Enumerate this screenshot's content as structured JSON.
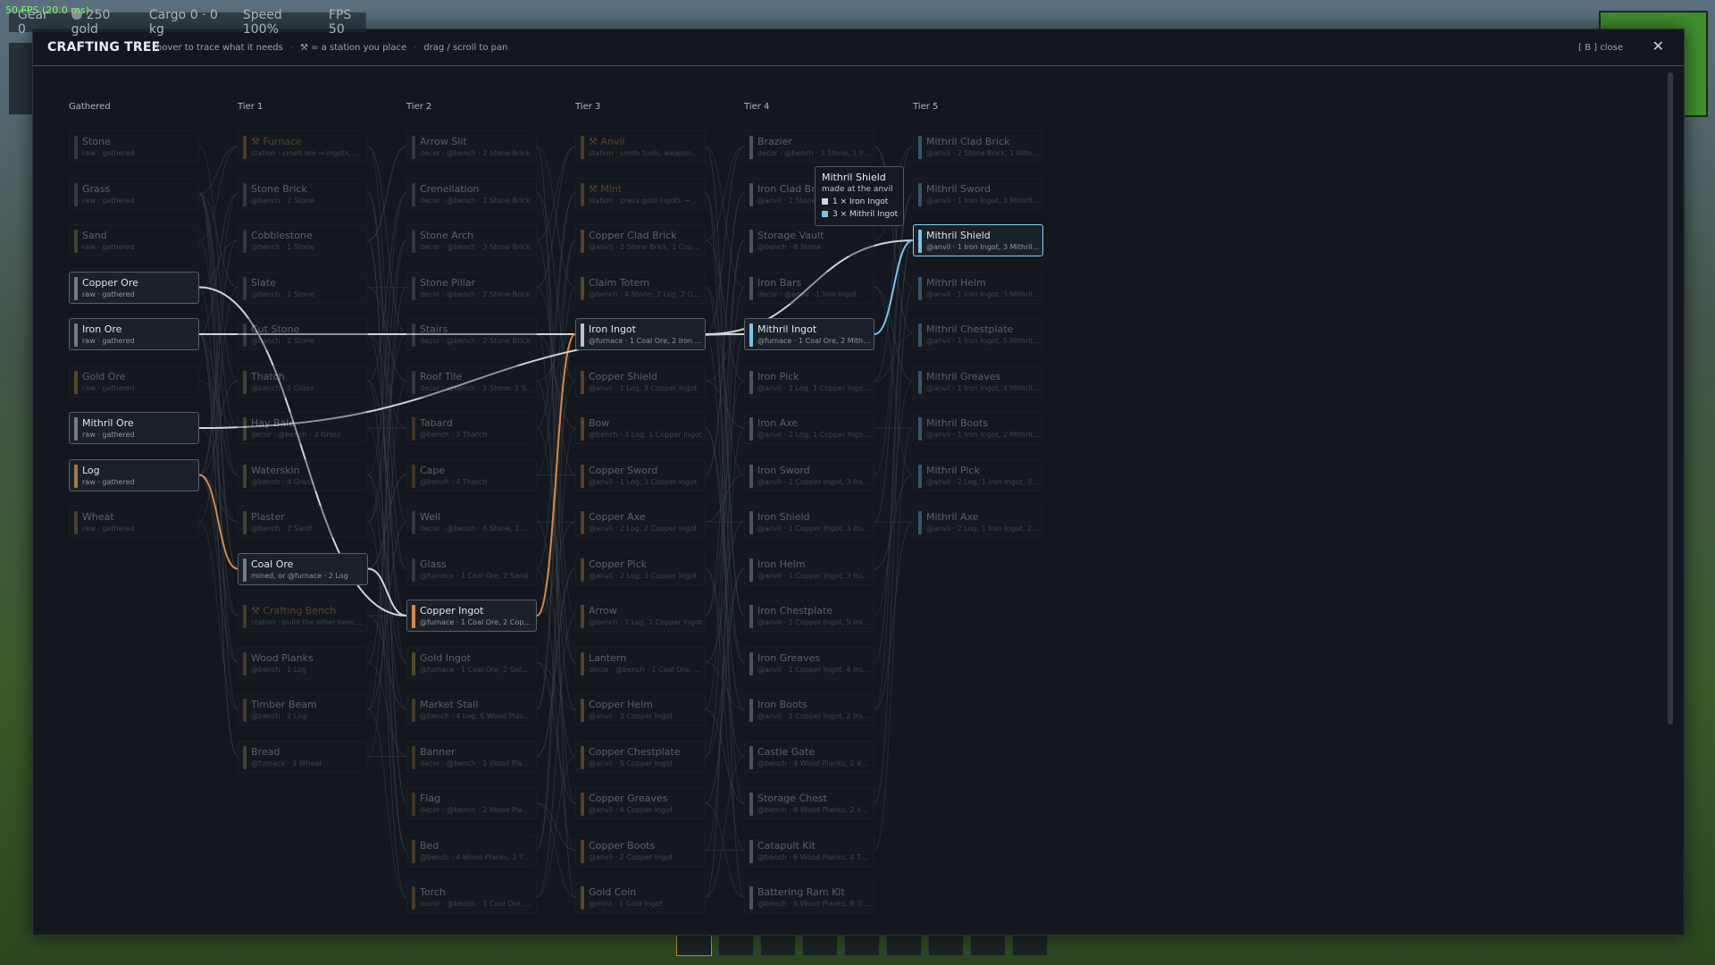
{
  "colors": {
    "raw": "#737c85",
    "station": "#b28432",
    "copper": "#d98845",
    "iron": "#bcc3ca",
    "mithril": "#77c6e6",
    "gold": "#c9a23a",
    "wood": "#a47a48",
    "food": "#a58b55",
    "stone": "#6d757d",
    "decor": "#8d6a3a",
    "selected": "#7fd3f2",
    "accent": "#c9913a"
  },
  "overlay": {
    "fps": "50 FPS  (20.0 ms)"
  },
  "hud": {
    "gear": "Gear 0",
    "gold": "250 gold",
    "cargo": "Cargo 0 · 0 kg",
    "speed": "Speed 100%",
    "fps": "FPS 50"
  },
  "modal": {
    "title": "CRAFTING TREE",
    "hints": [
      "hover to trace what it needs",
      "⚒ = a station you place",
      "drag / scroll to pan"
    ],
    "hint_sep": "·",
    "close_hint": "[ B ]  close",
    "close_icon": "✕"
  },
  "tooltip": {
    "title": "Mithril Shield",
    "subtitle": "made at the anvil",
    "items": [
      {
        "label": "1 × Iron Ingot",
        "color": "#cfd5da"
      },
      {
        "label": "3 × Mithril Ingot",
        "color": "#77c6e6"
      }
    ]
  },
  "columns": [
    {
      "header": "Gathered",
      "nodes": [
        {
          "name": "Stone",
          "sub": "raw · gathered",
          "kind": "stone",
          "hl": false
        },
        {
          "name": "Grass",
          "sub": "raw · gathered",
          "kind": "raw",
          "hl": false
        },
        {
          "name": "Sand",
          "sub": "raw · gathered",
          "kind": "food",
          "hl": false
        },
        {
          "name": "Copper Ore",
          "sub": "raw · gathered",
          "kind": "raw",
          "hl": true
        },
        {
          "name": "Iron Ore",
          "sub": "raw · gathered",
          "kind": "raw",
          "hl": true
        },
        {
          "name": "Gold Ore",
          "sub": "raw · gathered",
          "kind": "gold",
          "hl": false
        },
        {
          "name": "Mithril Ore",
          "sub": "raw · gathered",
          "kind": "raw",
          "hl": true
        },
        {
          "name": "Log",
          "sub": "raw · gathered",
          "kind": "wood",
          "hl": true
        },
        {
          "name": "Wheat",
          "sub": "raw · gathered",
          "kind": "food",
          "hl": false
        }
      ]
    },
    {
      "header": "Tier 1",
      "nodes": [
        {
          "name": "⚒ Furnace",
          "sub": "station · smelt ore → ingots, ...",
          "kind": "station",
          "hl": false
        },
        {
          "name": "Stone Brick",
          "sub": "@bench · 2 Stone",
          "kind": "stone",
          "hl": false
        },
        {
          "name": "Cobblestone",
          "sub": "@bench · 1 Stone",
          "kind": "stone",
          "hl": false
        },
        {
          "name": "Slate",
          "sub": "@bench · 2 Stone",
          "kind": "stone",
          "hl": false
        },
        {
          "name": "Cut Stone",
          "sub": "@bench · 2 Stone",
          "kind": "stone",
          "hl": false
        },
        {
          "name": "Thatch",
          "sub": "@bench · 2 Grass",
          "kind": "food",
          "hl": false
        },
        {
          "name": "Hay Bale",
          "sub": "decor · @bench · 3 Grass",
          "kind": "food",
          "hl": false
        },
        {
          "name": "Waterskin",
          "sub": "@bench · 4 Grass",
          "kind": "food",
          "hl": false
        },
        {
          "name": "Plaster",
          "sub": "@bench · 2 Sand",
          "kind": "food",
          "hl": false
        },
        {
          "name": "Coal Ore",
          "sub": "mined, or @furnace · 2 Log",
          "kind": "raw",
          "hl": true
        },
        {
          "name": "⚒ Crafting Bench",
          "sub": "station · build the other benc...",
          "kind": "station",
          "hl": false
        },
        {
          "name": "Wood Planks",
          "sub": "@bench · 1 Log",
          "kind": "wood",
          "hl": false
        },
        {
          "name": "Timber Beam",
          "sub": "@bench · 2 Log",
          "kind": "wood",
          "hl": false
        },
        {
          "name": "Bread",
          "sub": "@furnace · 3 Wheat",
          "kind": "food",
          "hl": false
        }
      ]
    },
    {
      "header": "Tier 2",
      "nodes": [
        {
          "name": "Arrow Slit",
          "sub": "decor · @bench · 2 Stone Brick",
          "kind": "stone",
          "hl": false
        },
        {
          "name": "Crenellation",
          "sub": "decor · @bench · 2 Stone Brick",
          "kind": "stone",
          "hl": false
        },
        {
          "name": "Stone Arch",
          "sub": "decor · @bench · 3 Stone Brick",
          "kind": "stone",
          "hl": false
        },
        {
          "name": "Stone Pillar",
          "sub": "decor · @bench · 2 Stone Brick",
          "kind": "stone",
          "hl": false
        },
        {
          "name": "Stairs",
          "sub": "decor · @bench · 2 Stone Brick",
          "kind": "stone",
          "hl": false
        },
        {
          "name": "Roof Tile",
          "sub": "decor · @bench · 1 Stone, 1 Sl...",
          "kind": "stone",
          "hl": false
        },
        {
          "name": "Tabard",
          "sub": "@bench · 3 Thatch",
          "kind": "decor",
          "hl": false
        },
        {
          "name": "Cape",
          "sub": "@bench · 4 Thatch",
          "kind": "decor",
          "hl": false
        },
        {
          "name": "Well",
          "sub": "decor · @bench · 6 Stone, 2 W...",
          "kind": "stone",
          "hl": false
        },
        {
          "name": "Glass",
          "sub": "@furnace · 1 Coal Ore, 2 Sand",
          "kind": "stone",
          "hl": false
        },
        {
          "name": "Copper Ingot",
          "sub": "@furnace · 1 Coal Ore, 2 Copp...",
          "kind": "copper",
          "hl": true
        },
        {
          "name": "Gold Ingot",
          "sub": "@furnace · 1 Coal Ore, 2 Gold ...",
          "kind": "gold",
          "hl": false
        },
        {
          "name": "Market Stall",
          "sub": "@bench · 4 Log, 6 Wood Plan...",
          "kind": "wood",
          "hl": false
        },
        {
          "name": "Banner",
          "sub": "decor · @bench · 1 Wood Plan...",
          "kind": "decor",
          "hl": false
        },
        {
          "name": "Flag",
          "sub": "decor · @bench · 2 Wood Plan...",
          "kind": "decor",
          "hl": false
        },
        {
          "name": "Bed",
          "sub": "@bench · 4 Wood Planks, 2 Th...",
          "kind": "wood",
          "hl": false
        },
        {
          "name": "Torch",
          "sub": "decor · @bench · 1 Coal Ore, ...",
          "kind": "wood",
          "hl": false
        }
      ]
    },
    {
      "header": "Tier 3",
      "nodes": [
        {
          "name": "⚒ Anvil",
          "sub": "station · smith tools, weapon...",
          "kind": "station",
          "hl": false
        },
        {
          "name": "⚒ Mint",
          "sub": "station · press gold ingots → c...",
          "kind": "station",
          "hl": false
        },
        {
          "name": "Copper Clad Brick",
          "sub": "@anvil · 2 Stone Brick, 1 Copp...",
          "kind": "copper",
          "hl": false
        },
        {
          "name": "Claim Totem",
          "sub": "@bench · 4 Stone, 2 Log, 2 Go...",
          "kind": "gold",
          "hl": false
        },
        {
          "name": "Iron Ingot",
          "sub": "@furnace · 1 Coal Ore, 2 Iron ...",
          "kind": "iron",
          "hl": true
        },
        {
          "name": "Copper Shield",
          "sub": "@anvil · 1 Log, 3 Copper Ingot",
          "kind": "copper",
          "hl": false
        },
        {
          "name": "Bow",
          "sub": "@bench · 3 Log, 1 Copper Ingot",
          "kind": "copper",
          "hl": false
        },
        {
          "name": "Copper Sword",
          "sub": "@anvil · 1 Log, 3 Copper Ingot",
          "kind": "copper",
          "hl": false
        },
        {
          "name": "Copper Axe",
          "sub": "@anvil · 2 Log, 2 Copper Ingot",
          "kind": "copper",
          "hl": false
        },
        {
          "name": "Copper Pick",
          "sub": "@anvil · 2 Log, 3 Copper Ingot",
          "kind": "copper",
          "hl": false
        },
        {
          "name": "Arrow",
          "sub": "@bench · 1 Log, 1 Copper Ingot",
          "kind": "copper",
          "hl": false
        },
        {
          "name": "Lantern",
          "sub": "decor · @bench · 1 Coal Ore, ...",
          "kind": "copper",
          "hl": false
        },
        {
          "name": "Copper Helm",
          "sub": "@anvil · 3 Copper Ingot",
          "kind": "copper",
          "hl": false
        },
        {
          "name": "Copper Chestplate",
          "sub": "@anvil · 5 Copper Ingot",
          "kind": "copper",
          "hl": false
        },
        {
          "name": "Copper Greaves",
          "sub": "@anvil · 4 Copper Ingot",
          "kind": "copper",
          "hl": false
        },
        {
          "name": "Copper Boots",
          "sub": "@anvil · 2 Copper Ingot",
          "kind": "copper",
          "hl": false
        },
        {
          "name": "Gold Coin",
          "sub": "@mint · 1 Gold Ingot",
          "kind": "gold",
          "hl": false
        }
      ]
    },
    {
      "header": "Tier 4",
      "nodes": [
        {
          "name": "Brazier",
          "sub": "decor · @bench · 3 Stone, 1 Ir...",
          "kind": "iron",
          "hl": false
        },
        {
          "name": "Iron Clad Brick",
          "sub": "@anvil · 2 Stone Brick, 1 Iron I...",
          "kind": "iron",
          "hl": false
        },
        {
          "name": "Storage Vault",
          "sub": "@bench · 8 Stone",
          "kind": "iron",
          "hl": false
        },
        {
          "name": "Iron Bars",
          "sub": "decor · @anvil · 1 Iron Ingot",
          "kind": "iron",
          "hl": false
        },
        {
          "name": "Mithril Ingot",
          "sub": "@furnace · 1 Coal Ore, 2 Mith...",
          "kind": "mithril",
          "hl": true
        },
        {
          "name": "Iron Pick",
          "sub": "@anvil · 2 Log, 1 Copper Ingot...",
          "kind": "iron",
          "hl": false
        },
        {
          "name": "Iron Axe",
          "sub": "@anvil · 2 Log, 1 Copper Ingot...",
          "kind": "iron",
          "hl": false
        },
        {
          "name": "Iron Sword",
          "sub": "@anvil · 1 Copper Ingot, 3 Iro...",
          "kind": "iron",
          "hl": false
        },
        {
          "name": "Iron Shield",
          "sub": "@anvil · 1 Copper Ingot, 3 Iro...",
          "kind": "iron",
          "hl": false
        },
        {
          "name": "Iron Helm",
          "sub": "@anvil · 1 Copper Ingot, 3 Iro...",
          "kind": "iron",
          "hl": false
        },
        {
          "name": "Iron Chestplate",
          "sub": "@anvil · 1 Copper Ingot, 5 Iro...",
          "kind": "iron",
          "hl": false
        },
        {
          "name": "Iron Greaves",
          "sub": "@anvil · 1 Copper Ingot, 4 Iro...",
          "kind": "iron",
          "hl": false
        },
        {
          "name": "Iron Boots",
          "sub": "@anvil · 1 Copper Ingot, 2 Iro...",
          "kind": "iron",
          "hl": false
        },
        {
          "name": "Castle Gate",
          "sub": "@bench · 4 Wood Planks, 2 Ir...",
          "kind": "iron",
          "hl": false
        },
        {
          "name": "Storage Chest",
          "sub": "@bench · 8 Wood Planks, 2 Ir...",
          "kind": "iron",
          "hl": false
        },
        {
          "name": "Catapult Kit",
          "sub": "@bench · 6 Wood Planks, 4 Th...",
          "kind": "iron",
          "hl": false
        },
        {
          "name": "Battering Ram Kit",
          "sub": "@bench · 6 Wood Planks, 8 Ti...",
          "kind": "iron",
          "hl": false
        }
      ]
    },
    {
      "header": "Tier 5",
      "nodes": [
        {
          "name": "Mithril Clad Brick",
          "sub": "@anvil · 2 Stone Brick, 1 Mith...",
          "kind": "mithril",
          "hl": false
        },
        {
          "name": "Mithril Sword",
          "sub": "@anvil · 1 Iron Ingot, 3 Mithril...",
          "kind": "mithril",
          "hl": false
        },
        {
          "name": "Mithril Shield",
          "sub": "@anvil · 1 Iron Ingot, 3 Mithril...",
          "kind": "mithril",
          "hl": true,
          "selected": true
        },
        {
          "name": "Mithril Helm",
          "sub": "@anvil · 1 Iron Ingot, 3 Mithril...",
          "kind": "mithril",
          "hl": false
        },
        {
          "name": "Mithril Chestplate",
          "sub": "@anvil · 1 Iron Ingot, 5 Mithril...",
          "kind": "mithril",
          "hl": false
        },
        {
          "name": "Mithril Greaves",
          "sub": "@anvil · 1 Iron Ingot, 4 Mithril...",
          "kind": "mithril",
          "hl": false
        },
        {
          "name": "Mithril Boots",
          "sub": "@anvil · 1 Iron Ingot, 2 Mithril...",
          "kind": "mithril",
          "hl": false
        },
        {
          "name": "Mithril Pick",
          "sub": "@anvil · 2 Log, 1 Iron Ingot, 3...",
          "kind": "mithril",
          "hl": false
        },
        {
          "name": "Mithril Axe",
          "sub": "@anvil · 2 Log, 1 Iron Ingot, 2...",
          "kind": "mithril",
          "hl": false
        }
      ]
    }
  ],
  "highlight_edges": [
    {
      "from": "Copper Ore",
      "to": "Copper Ingot",
      "color": "#cfd5da"
    },
    {
      "from": "Coal Ore",
      "to": "Copper Ingot",
      "color": "#cfd5da"
    },
    {
      "from": "Log",
      "to": "Coal Ore",
      "color": "#d98845"
    },
    {
      "from": "Iron Ore",
      "to": "Iron Ingot",
      "color": "#cfd5da"
    },
    {
      "from": "Copper Ingot",
      "to": "Iron Ingot",
      "color": "#d98845"
    },
    {
      "from": "Mithril Ore",
      "to": "Mithril Ingot",
      "color": "#cfd5da"
    },
    {
      "from": "Iron Ingot",
      "to": "Mithril Ingot",
      "color": "#cfd5da"
    },
    {
      "from": "Iron Ingot",
      "to": "Mithril Shield",
      "color": "#cfd5da"
    },
    {
      "from": "Mithril Ingot",
      "to": "Mithril Shield",
      "color": "#77c6e6"
    }
  ],
  "hotbar_slots": 9
}
